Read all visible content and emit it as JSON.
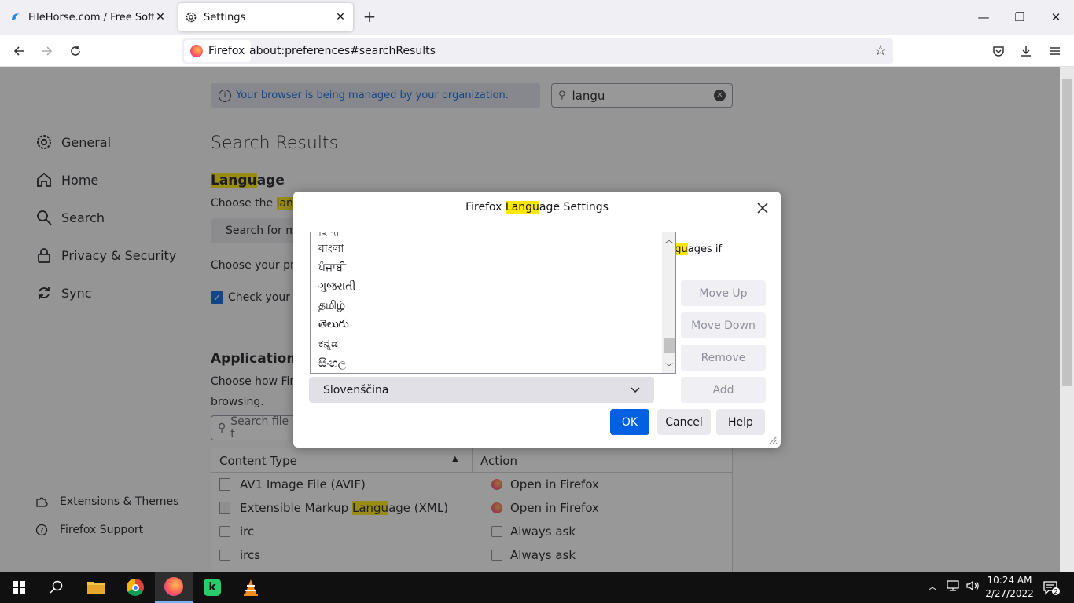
{
  "tabs": [
    {
      "title": "FileHorse.com / Free Software Downl",
      "icon": "filehorse-icon"
    },
    {
      "title": "Settings",
      "icon": "gear-icon"
    }
  ],
  "nav": {
    "identity_label": "Firefox",
    "url": "about:preferences#searchResults"
  },
  "banner": {
    "text": "Your browser is being managed by your organization."
  },
  "search": {
    "value": "langu"
  },
  "sidebar": {
    "items": [
      {
        "label": "General"
      },
      {
        "label": "Home"
      },
      {
        "label": "Search"
      },
      {
        "label": "Privacy & Security"
      },
      {
        "label": "Sync"
      }
    ],
    "footer": [
      {
        "label": "Extensions & Themes"
      },
      {
        "label": "Firefox Support"
      }
    ]
  },
  "main": {
    "heading": "Search Results",
    "language_section": {
      "title_pre": "",
      "title_hl": "Langu",
      "title_post": "age",
      "choose_text_pre": "Choose the ",
      "choose_text_hl": "lang",
      "search_btn": "Search for m",
      "preferred_text": "Choose your pre",
      "check_text": "Check your s"
    },
    "applications": {
      "title": "Applications",
      "desc1": "Choose how Fire",
      "desc2": "browsing.",
      "search_placeholder": "Search file t",
      "columns": {
        "content_type": "Content Type",
        "action": "Action"
      },
      "rows": [
        {
          "type_pre": "AV1 Image File (AVIF)",
          "type_hl": "",
          "type_post": "",
          "action": "Open in Firefox"
        },
        {
          "type_pre": "Extensible Markup ",
          "type_hl": "Langu",
          "type_post": "age (XML)",
          "action": "Open in Firefox"
        },
        {
          "type_pre": "irc",
          "type_hl": "",
          "type_post": "",
          "action": "Always ask"
        },
        {
          "type_pre": "ircs",
          "type_hl": "",
          "type_post": "",
          "action": "Always ask"
        }
      ]
    }
  },
  "dialog": {
    "title_pre": "Firefox ",
    "title_hl": "Langu",
    "title_post": "age Settings",
    "behind_text_hl": "ngu",
    "behind_text_post": "ages if",
    "languages": [
      "বাংলা",
      "ਪੰਜਾਬੀ",
      "ગુજરાતી",
      "தமிழ்",
      "తెలుగు",
      "ಕನ್ನಡ",
      "සිංහල"
    ],
    "selected": "Slovenščina",
    "buttons": {
      "move_up": "Move Up",
      "move_down": "Move Down",
      "remove": "Remove",
      "add": "Add",
      "ok": "OK",
      "cancel": "Cancel",
      "help": "Help"
    }
  },
  "taskbar": {
    "time": "10:24 AM",
    "date": "2/27/2022"
  },
  "colors": {
    "accent": "#0061e0",
    "highlight": "#ffe900",
    "taskbar": "#101010"
  }
}
